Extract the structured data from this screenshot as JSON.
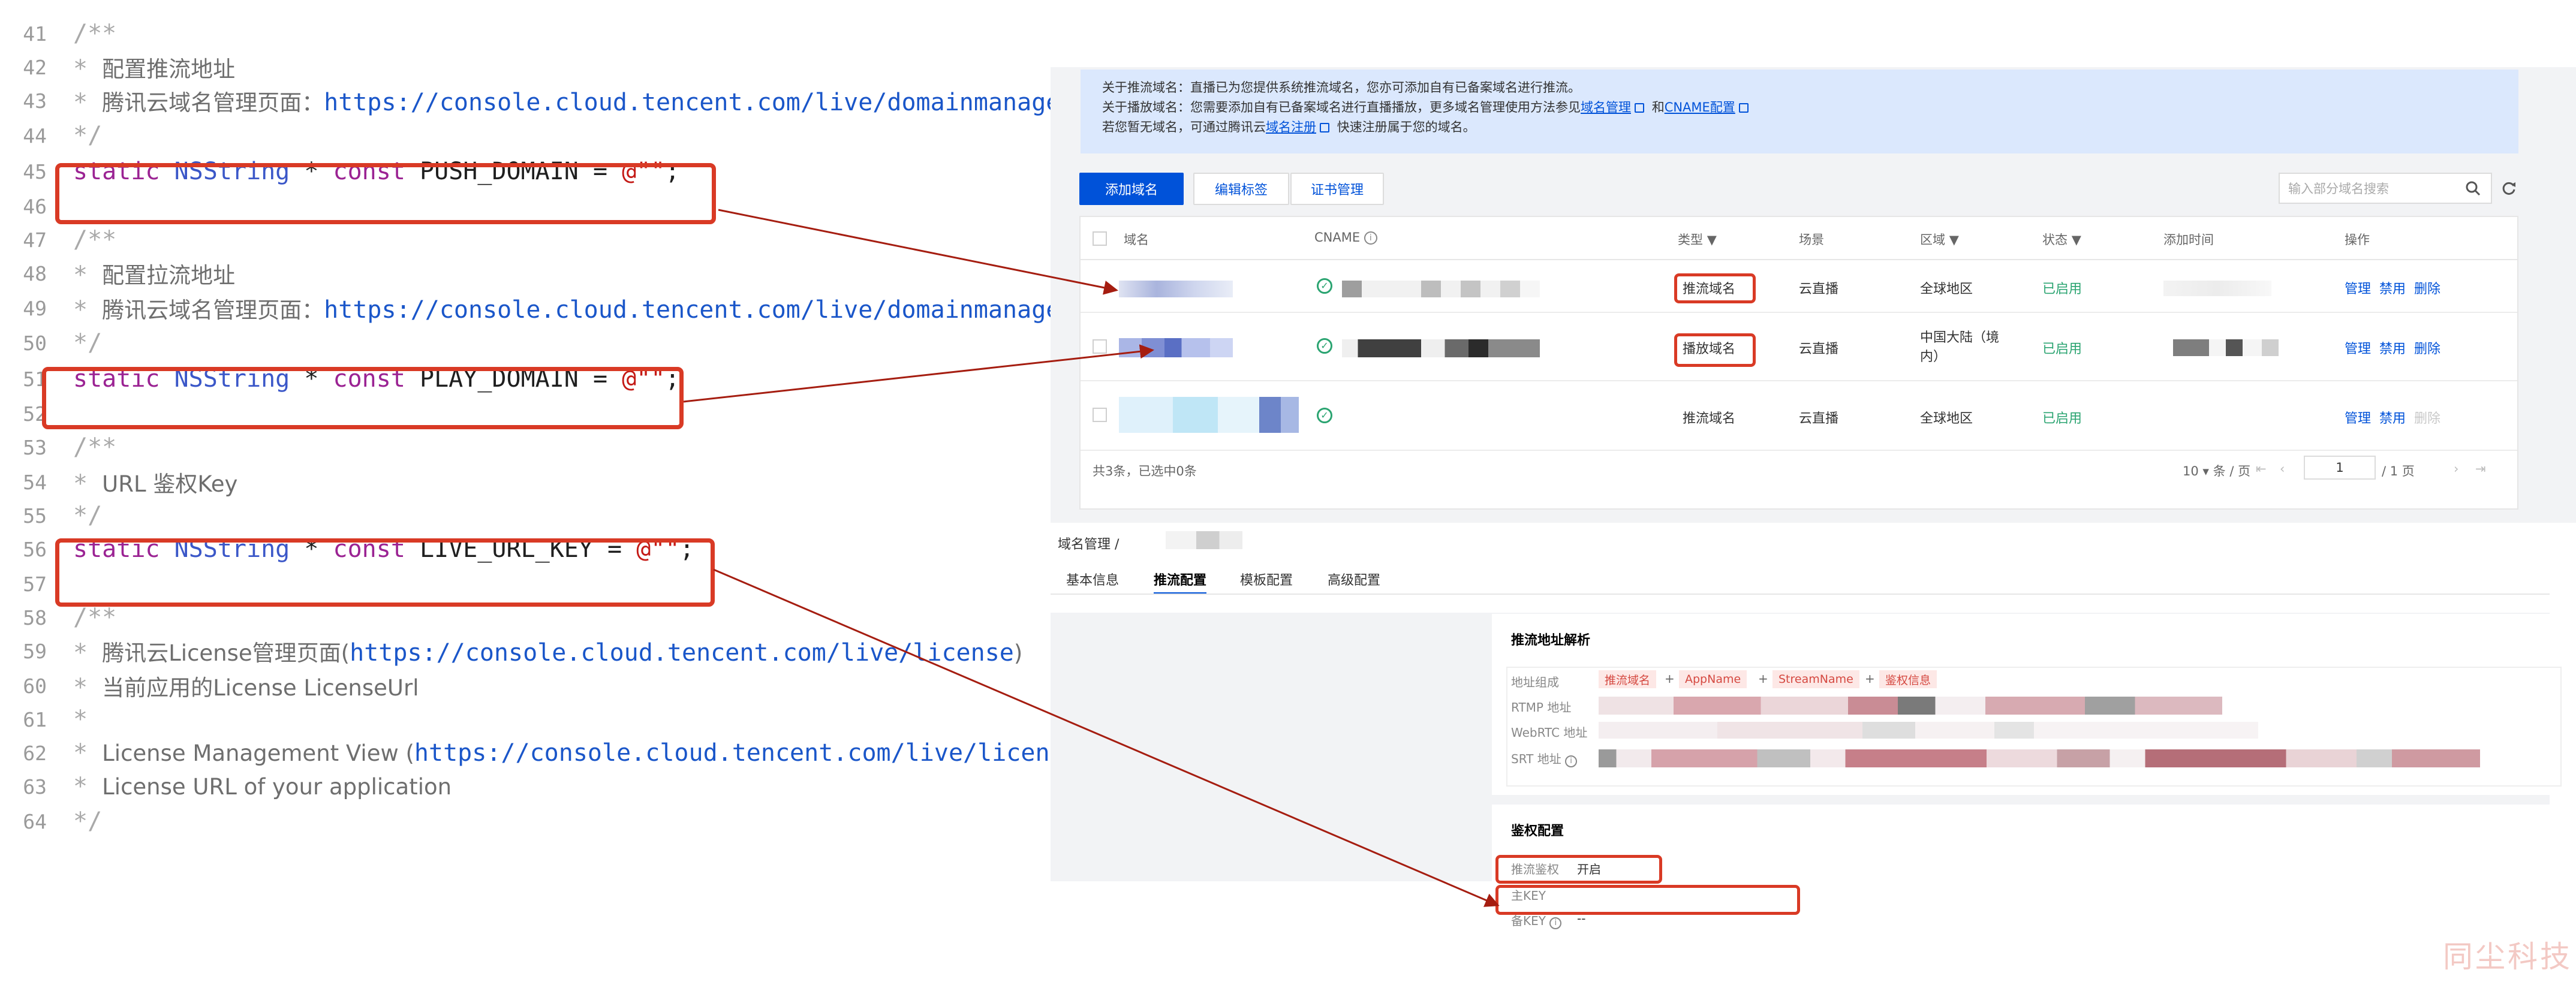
{
  "code": {
    "lines": [
      {
        "n": "41",
        "kind": "comment",
        "text": "/**"
      },
      {
        "n": "42",
        "kind": "comment-cn",
        "text": "配置推流地址"
      },
      {
        "n": "43",
        "kind": "comment-cn-url",
        "text": "腾讯云域名管理页面：",
        "url": "https://console.cloud.tencent.com/live/domainmanage"
      },
      {
        "n": "44",
        "kind": "comment",
        "text": "*/"
      },
      {
        "n": "45",
        "kind": "decl",
        "name": "PUSH_DOMAIN"
      },
      {
        "n": "46",
        "kind": "blank"
      },
      {
        "n": "47",
        "kind": "comment",
        "text": "/**"
      },
      {
        "n": "48",
        "kind": "comment-cn",
        "text": "配置拉流地址"
      },
      {
        "n": "49",
        "kind": "comment-cn-url",
        "text": "腾讯云域名管理页面：",
        "url": "https://console.cloud.tencent.com/live/domainmanage"
      },
      {
        "n": "50",
        "kind": "comment",
        "text": "*/"
      },
      {
        "n": "51",
        "kind": "decl",
        "name": "PLAY_DOMAIN"
      },
      {
        "n": "52",
        "kind": "blank"
      },
      {
        "n": "53",
        "kind": "comment",
        "text": "/**"
      },
      {
        "n": "54",
        "kind": "comment-cn",
        "text": "URL 鉴权Key"
      },
      {
        "n": "55",
        "kind": "comment",
        "text": "*/"
      },
      {
        "n": "56",
        "kind": "decl",
        "name": "LIVE_URL_KEY"
      },
      {
        "n": "57",
        "kind": "blank"
      },
      {
        "n": "58",
        "kind": "comment",
        "text": "/**"
      },
      {
        "n": "59",
        "kind": "comment-cn-paren",
        "text": "腾讯云License管理页面",
        "url": "https://console.cloud.tencent.com/live/license"
      },
      {
        "n": "60",
        "kind": "comment-cn",
        "text": "当前应用的License LicenseUrl"
      },
      {
        "n": "61",
        "kind": "comment-star"
      },
      {
        "n": "62",
        "kind": "comment-cn-paren",
        "text": "License Management View ",
        "url": "https://console.cloud.tencent.com/live/license"
      },
      {
        "n": "63",
        "kind": "comment-cn",
        "text": "License URL of your application"
      },
      {
        "n": "64",
        "kind": "comment",
        "text": "*/"
      }
    ],
    "tokens": {
      "static": "static",
      "type": "NSString",
      "star": "*",
      "const": "const",
      "eq": "=",
      "value": "@\"\"",
      "semi": ";",
      "star_prefix": "*"
    }
  },
  "domain_list": {
    "notice": {
      "line1": "关于推流域名：直播已为您提供系统推流域名，您亦可添加自有已备案域名进行推流。",
      "line2_prefix": "关于播放域名：您需要添加自有已备案域名进行直播播放，更多域名管理使用方法参见",
      "line2_link1": "域名管理",
      "line2_mid": "和",
      "line2_link2": "CNAME配置",
      "line3_prefix": "若您暂无域名，可通过腾讯云",
      "line3_link": "域名注册",
      "line3_suffix": "快速注册属于您的域名。"
    },
    "buttons": {
      "add": "添加域名",
      "edit_tags": "编辑标签",
      "cert": "证书管理"
    },
    "search_placeholder": "输入部分域名搜索",
    "columns": {
      "domain": "域名",
      "cname": "CNAME",
      "type": "类型",
      "scene": "场景",
      "region": "区域",
      "status": "状态",
      "added": "添加时间",
      "ops": "操作"
    },
    "rows": [
      {
        "type": "推流域名",
        "scene": "云直播",
        "region": "全球地区",
        "status": "已启用",
        "ops": [
          "管理",
          "禁用",
          "删除"
        ]
      },
      {
        "type": "播放域名",
        "scene": "云直播",
        "region": "中国大陆（境",
        "region2": "内）",
        "status": "已启用",
        "ops": [
          "管理",
          "禁用",
          "删除"
        ]
      },
      {
        "type": "推流域名",
        "scene": "云直播",
        "region": "全球地区",
        "status": "已启用",
        "ops": [
          "管理",
          "禁用",
          "删除"
        ]
      }
    ],
    "footer": {
      "summary": "共3条，已选中0条",
      "page_size": "10",
      "per_page": "条 / 页",
      "page": "1",
      "total_pages": "/ 1 页"
    }
  },
  "domain_detail": {
    "breadcrumb": "域名管理 /",
    "tabs": [
      "基本信息",
      "推流配置",
      "模板配置",
      "高级配置"
    ],
    "active_tab": "推流配置",
    "push_parse": {
      "title": "推流地址解析",
      "addr_label": "地址组成",
      "tags": [
        "推流域名",
        "AppName",
        "StreamName",
        "鉴权信息"
      ],
      "plus": "+",
      "rtmp": "RTMP 地址",
      "webrtc": "WebRTC 地址",
      "srt": "SRT 地址"
    },
    "auth": {
      "title": "鉴权配置",
      "push_auth": "推流鉴权",
      "push_auth_value": "开启",
      "main_key": "主KEY",
      "backup_key": "备KEY",
      "backup_key_value": "--"
    }
  },
  "watermark": "同尘科技",
  "colors": {
    "highlight": "#d93a25",
    "brand": "#0052d9",
    "success": "#2ba471"
  }
}
